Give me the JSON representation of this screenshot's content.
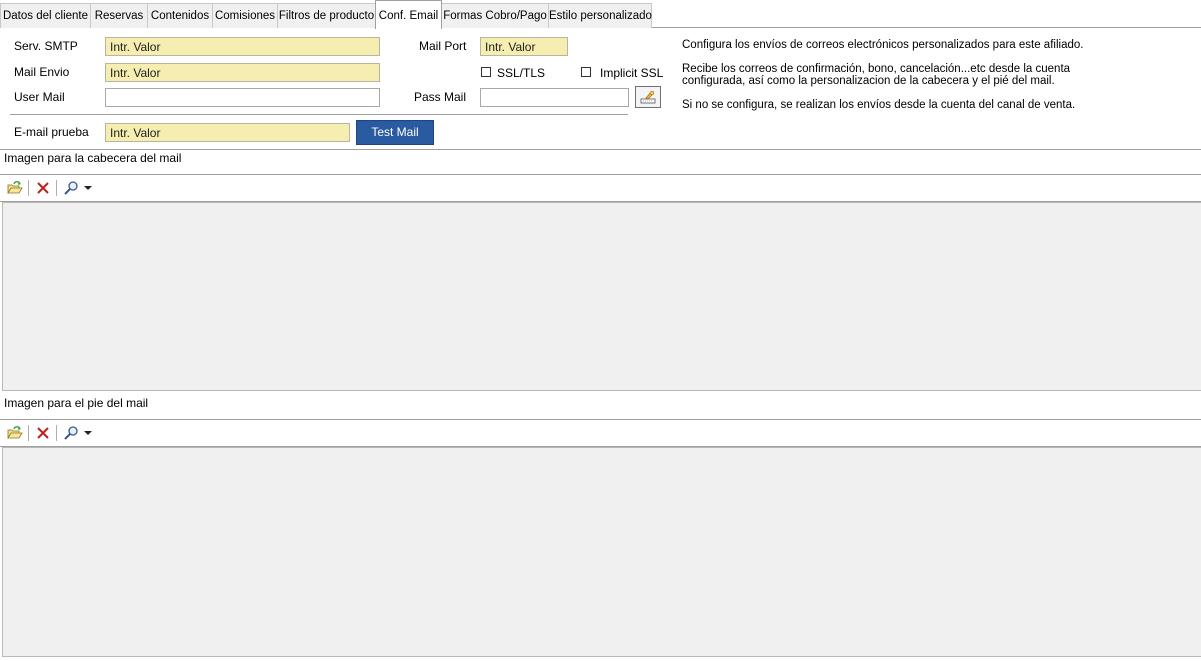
{
  "tabs": [
    {
      "label": "Datos del cliente"
    },
    {
      "label": "Reservas"
    },
    {
      "label": "Contenidos"
    },
    {
      "label": "Comisiones"
    },
    {
      "label": "Filtros de producto"
    },
    {
      "label": "Conf. Email"
    },
    {
      "label": "Formas Cobro/Pago"
    },
    {
      "label": "Estilo personalizado"
    }
  ],
  "active_tab": "Conf. Email",
  "form": {
    "smtp": {
      "label": "Serv. SMTP",
      "placeholder": "Intr. Valor"
    },
    "mail_port": {
      "label": "Mail Port",
      "placeholder": "Intr. Valor"
    },
    "mail_envio": {
      "label": "Mail Envio",
      "placeholder": "Intr. Valor"
    },
    "ssl_tls": {
      "label": "SSL/TLS",
      "checked": false
    },
    "implicit_ssl": {
      "label": "Implicit SSL",
      "checked": false
    },
    "user_mail": {
      "label": "User Mail",
      "value": ""
    },
    "pass_mail": {
      "label": "Pass Mail",
      "value": ""
    },
    "email_prueba": {
      "label": "E-mail prueba",
      "placeholder": "Intr. Valor"
    },
    "test_button": "Test Mail"
  },
  "info": {
    "line1": "Configura los envíos de correos electrónicos personalizados para este afiliado.",
    "line2a": "Recibe los correos de confirmación, bono, cancelación...etc desde la cuenta",
    "line2b": "configurada, así como la personalizacion de la cabecera y el pié del mail.",
    "line3": "Si no se configura, se realizan los envíos desde la cuenta del canal de venta."
  },
  "header_image": {
    "label": "Imagen para la cabecera del mail"
  },
  "footer_image": {
    "label": "Imagen para el pie del mail"
  },
  "icons": {
    "load": "folder-open-icon",
    "delete": "delete-x-icon",
    "zoom": "zoom-icon",
    "dropdown": "chevron-down-icon",
    "password": "key-icon"
  },
  "colors": {
    "required_field": "#f5eeb0",
    "test_button": "#2a5aa0",
    "delete_icon": "#c0201a",
    "panel_bg": "#f0f0f0"
  }
}
